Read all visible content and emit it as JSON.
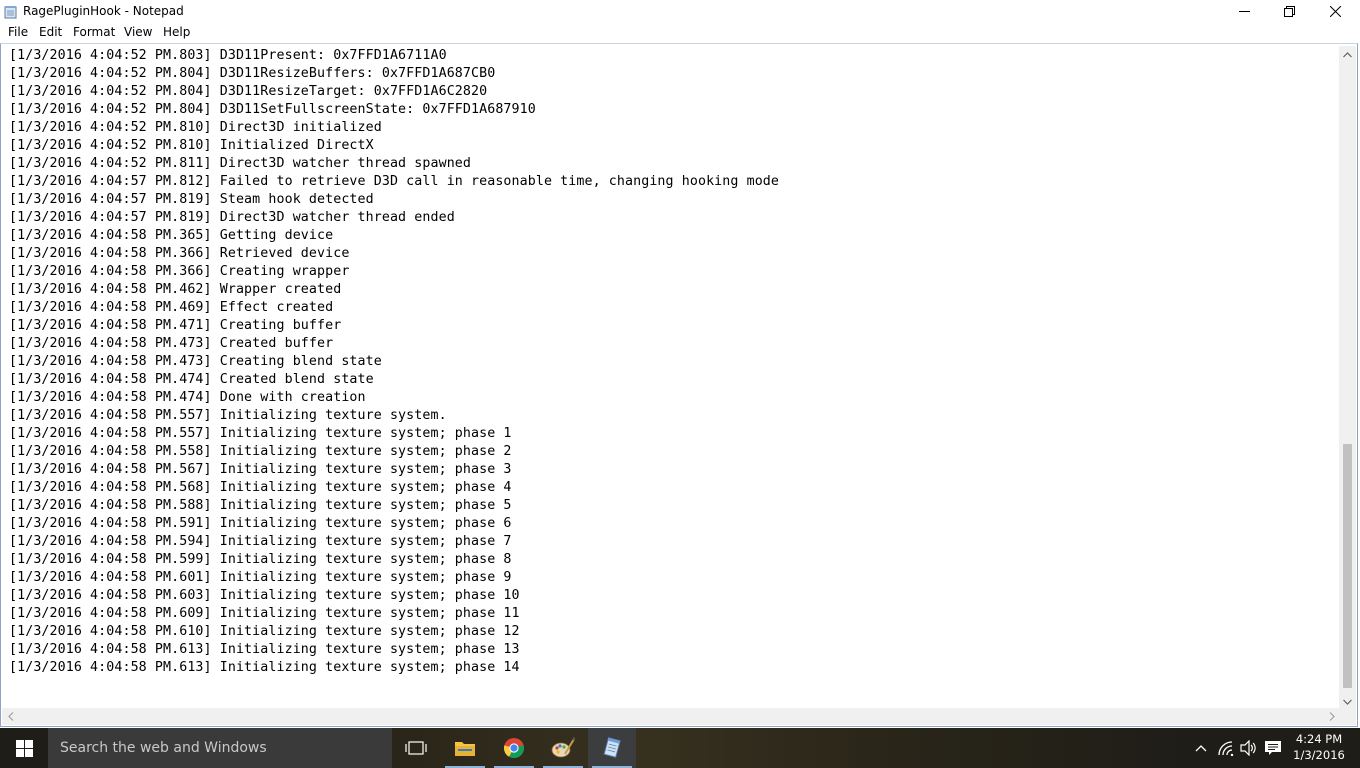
{
  "window": {
    "title": "RagePluginHook - Notepad"
  },
  "menu": {
    "items": [
      "File",
      "Edit",
      "Format",
      "View",
      "Help"
    ]
  },
  "document": {
    "lines": [
      "[1/3/2016 4:04:52 PM.803] D3D11Present: 0x7FFD1A6711A0",
      "[1/3/2016 4:04:52 PM.804] D3D11ResizeBuffers: 0x7FFD1A687CB0",
      "[1/3/2016 4:04:52 PM.804] D3D11ResizeTarget: 0x7FFD1A6C2820",
      "[1/3/2016 4:04:52 PM.804] D3D11SetFullscreenState: 0x7FFD1A687910",
      "[1/3/2016 4:04:52 PM.810] Direct3D initialized",
      "[1/3/2016 4:04:52 PM.810] Initialized DirectX",
      "[1/3/2016 4:04:52 PM.811] Direct3D watcher thread spawned",
      "[1/3/2016 4:04:57 PM.812] Failed to retrieve D3D call in reasonable time, changing hooking mode",
      "[1/3/2016 4:04:57 PM.819] Steam hook detected",
      "[1/3/2016 4:04:57 PM.819] Direct3D watcher thread ended",
      "[1/3/2016 4:04:58 PM.365] Getting device",
      "[1/3/2016 4:04:58 PM.366] Retrieved device",
      "[1/3/2016 4:04:58 PM.366] Creating wrapper",
      "[1/3/2016 4:04:58 PM.462] Wrapper created",
      "[1/3/2016 4:04:58 PM.469] Effect created",
      "[1/3/2016 4:04:58 PM.471] Creating buffer",
      "[1/3/2016 4:04:58 PM.473] Created buffer",
      "[1/3/2016 4:04:58 PM.473] Creating blend state",
      "[1/3/2016 4:04:58 PM.474] Created blend state",
      "[1/3/2016 4:04:58 PM.474] Done with creation",
      "[1/3/2016 4:04:58 PM.557] Initializing texture system.",
      "[1/3/2016 4:04:58 PM.557] Initializing texture system; phase 1",
      "[1/3/2016 4:04:58 PM.558] Initializing texture system; phase 2",
      "[1/3/2016 4:04:58 PM.567] Initializing texture system; phase 3",
      "[1/3/2016 4:04:58 PM.568] Initializing texture system; phase 4",
      "[1/3/2016 4:04:58 PM.588] Initializing texture system; phase 5",
      "[1/3/2016 4:04:58 PM.591] Initializing texture system; phase 6",
      "[1/3/2016 4:04:58 PM.594] Initializing texture system; phase 7",
      "[1/3/2016 4:04:58 PM.599] Initializing texture system; phase 8",
      "[1/3/2016 4:04:58 PM.601] Initializing texture system; phase 9",
      "[1/3/2016 4:04:58 PM.603] Initializing texture system; phase 10",
      "[1/3/2016 4:04:58 PM.609] Initializing texture system; phase 11",
      "[1/3/2016 4:04:58 PM.610] Initializing texture system; phase 12",
      "[1/3/2016 4:04:58 PM.613] Initializing texture system; phase 13",
      "[1/3/2016 4:04:58 PM.613] Initializing texture system; phase 14"
    ]
  },
  "taskbar": {
    "search_placeholder": "Search the web and Windows",
    "apps": [
      {
        "name": "task-view",
        "icon": "task-view-icon"
      },
      {
        "name": "file-explorer",
        "icon": "folder-icon"
      },
      {
        "name": "chrome",
        "icon": "chrome-icon"
      },
      {
        "name": "paint",
        "icon": "paint-icon"
      },
      {
        "name": "notepad",
        "icon": "notepad-icon",
        "active": true
      }
    ],
    "clock_time": "4:24 PM",
    "clock_date": "1/3/2016"
  },
  "colors": {
    "taskbar": "#1f1d18",
    "search_box": "#3a3a3a",
    "running_indicator": "#8fb3d9",
    "scroll_thumb": "#c1c1c1"
  }
}
